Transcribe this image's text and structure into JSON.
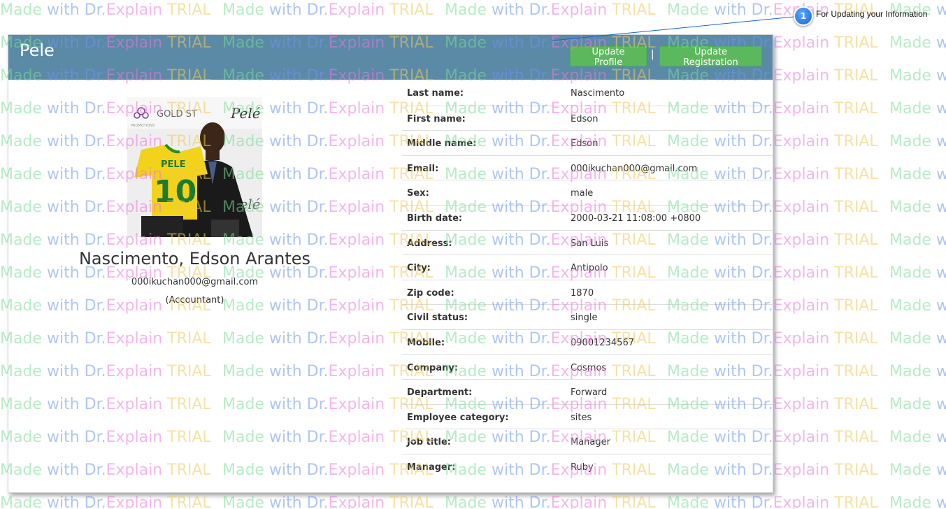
{
  "header": {
    "title": "Pele",
    "update_profile_label": "Update Profile",
    "separator": "|",
    "update_registration_label": "Update Registration"
  },
  "callout": {
    "number": "1",
    "text": "For Updating your Information"
  },
  "watermark": {
    "part1": "Made",
    "part2": "with",
    "part3": "Dr.",
    "part4": "Explain",
    "part5": "TRIAL"
  },
  "profile": {
    "full_name": "Nascimento, Edson Arantes",
    "email": "000ikuchan000@gmail.com",
    "role": "(Accountant)",
    "photo_shirt_text": "PELE",
    "photo_number": "10",
    "photo_sponsor": "GOLD ST",
    "photo_sponsor_sub": "PROMOTIONS",
    "photo_signature": "Pelé"
  },
  "details": [
    {
      "label": "Last name:",
      "value": "Nascimento"
    },
    {
      "label": "First name:",
      "value": "Edson"
    },
    {
      "label": "Middle name:",
      "value": "Edson"
    },
    {
      "label": "Email:",
      "value": "000ikuchan000@gmail.com"
    },
    {
      "label": "Sex:",
      "value": "male"
    },
    {
      "label": "Birth date:",
      "value": "2000-03-21 11:08:00 +0800"
    },
    {
      "label": "Address:",
      "value": "San Luis"
    },
    {
      "label": "City:",
      "value": "Antipolo"
    },
    {
      "label": "Zip code:",
      "value": "1870"
    },
    {
      "label": "Civil status:",
      "value": "single"
    },
    {
      "label": "Mobile:",
      "value": "09001234567"
    },
    {
      "label": "Company:",
      "value": "Cosmos"
    },
    {
      "label": "Department:",
      "value": "Forward"
    },
    {
      "label": "Employee category:",
      "value": "sites"
    },
    {
      "label": "Job title:",
      "value": "Manager"
    },
    {
      "label": "Manager:",
      "value": "Ruby"
    }
  ],
  "colors": {
    "header_bg": "#5a8aa6",
    "button_green": "#5cb85c",
    "callout_blue": "#1565d8"
  }
}
